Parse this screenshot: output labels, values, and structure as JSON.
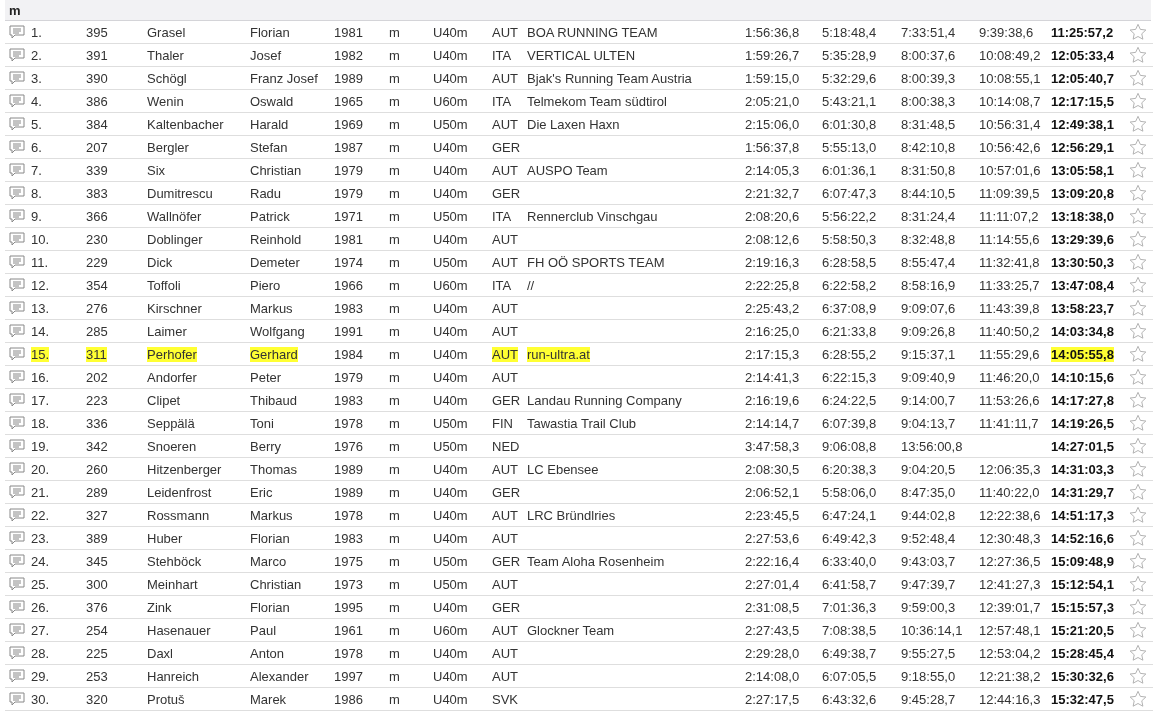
{
  "group": {
    "label": "m"
  },
  "rows": [
    {
      "rank": "1.",
      "bib": "395",
      "last_name": "Grasel",
      "first_name": "Florian",
      "year": "1981",
      "sex": "m",
      "category": "U40m",
      "nation": "AUT",
      "club": "BOA RUNNING TEAM",
      "split_1": "1:56:36,8",
      "split_2": "5:18:48,4",
      "split_3": "7:33:51,4",
      "split_4": "9:39:38,6",
      "final_time": "11:25:57,2",
      "highlighted": false,
      "favorite": false
    },
    {
      "rank": "2.",
      "bib": "391",
      "last_name": "Thaler",
      "first_name": "Josef",
      "year": "1982",
      "sex": "m",
      "category": "U40m",
      "nation": "ITA",
      "club": "VERTICAL ULTEN",
      "split_1": "1:59:26,7",
      "split_2": "5:35:28,9",
      "split_3": "8:00:37,6",
      "split_4": "10:08:49,2",
      "final_time": "12:05:33,4",
      "highlighted": false,
      "favorite": false
    },
    {
      "rank": "3.",
      "bib": "390",
      "last_name": "Schögl",
      "first_name": "Franz Josef",
      "year": "1989",
      "sex": "m",
      "category": "U40m",
      "nation": "AUT",
      "club": "Bjak's Running Team Austria",
      "split_1": "1:59:15,0",
      "split_2": "5:32:29,6",
      "split_3": "8:00:39,3",
      "split_4": "10:08:55,1",
      "final_time": "12:05:40,7",
      "highlighted": false,
      "favorite": false
    },
    {
      "rank": "4.",
      "bib": "386",
      "last_name": "Wenin",
      "first_name": "Oswald",
      "year": "1965",
      "sex": "m",
      "category": "U60m",
      "nation": "ITA",
      "club": "Telmekom Team südtirol",
      "split_1": "2:05:21,0",
      "split_2": "5:43:21,1",
      "split_3": "8:00:38,3",
      "split_4": "10:14:08,7",
      "final_time": "12:17:15,5",
      "highlighted": false,
      "favorite": false
    },
    {
      "rank": "5.",
      "bib": "384",
      "last_name": "Kaltenbacher",
      "first_name": "Harald",
      "year": "1969",
      "sex": "m",
      "category": "U50m",
      "nation": "AUT",
      "club": "Die Laxen Haxn",
      "split_1": "2:15:06,0",
      "split_2": "6:01:30,8",
      "split_3": "8:31:48,5",
      "split_4": "10:56:31,4",
      "final_time": "12:49:38,1",
      "highlighted": false,
      "favorite": false
    },
    {
      "rank": "6.",
      "bib": "207",
      "last_name": "Bergler",
      "first_name": "Stefan",
      "year": "1987",
      "sex": "m",
      "category": "U40m",
      "nation": "GER",
      "split_1": "1:56:37,8",
      "split_2": "5:55:13,0",
      "split_3": "8:42:10,8",
      "split_4": "10:56:42,6",
      "final_time": "12:56:29,1",
      "highlighted": false,
      "favorite": false
    },
    {
      "rank": "7.",
      "bib": "339",
      "last_name": "Six",
      "first_name": "Christian",
      "year": "1979",
      "sex": "m",
      "category": "U40m",
      "nation": "AUT",
      "club": "AUSPO Team",
      "split_1": "2:14:05,3",
      "split_2": "6:01:36,1",
      "split_3": "8:31:50,8",
      "split_4": "10:57:01,6",
      "final_time": "13:05:58,1",
      "highlighted": false,
      "favorite": false
    },
    {
      "rank": "8.",
      "bib": "383",
      "last_name": "Dumitrescu",
      "first_name": "Radu",
      "year": "1979",
      "sex": "m",
      "category": "U40m",
      "nation": "GER",
      "split_1": "2:21:32,7",
      "split_2": "6:07:47,3",
      "split_3": "8:44:10,5",
      "split_4": "11:09:39,5",
      "final_time": "13:09:20,8",
      "highlighted": false,
      "favorite": false
    },
    {
      "rank": "9.",
      "bib": "366",
      "last_name": "Wallnöfer",
      "first_name": "Patrick",
      "year": "1971",
      "sex": "m",
      "category": "U50m",
      "nation": "ITA",
      "club": "Rennerclub Vinschgau",
      "split_1": "2:08:20,6",
      "split_2": "5:56:22,2",
      "split_3": "8:31:24,4",
      "split_4": "11:11:07,2",
      "final_time": "13:18:38,0",
      "highlighted": false,
      "favorite": false
    },
    {
      "rank": "10.",
      "bib": "230",
      "last_name": "Doblinger",
      "first_name": "Reinhold",
      "year": "1981",
      "sex": "m",
      "category": "U40m",
      "nation": "AUT",
      "split_1": "2:08:12,6",
      "split_2": "5:58:50,3",
      "split_3": "8:32:48,8",
      "split_4": "11:14:55,6",
      "final_time": "13:29:39,6",
      "highlighted": false,
      "favorite": false
    },
    {
      "rank": "11.",
      "bib": "229",
      "last_name": "Dick",
      "first_name": "Demeter",
      "year": "1974",
      "sex": "m",
      "category": "U50m",
      "nation": "AUT",
      "club": "FH OÖ SPORTS TEAM",
      "split_1": "2:19:16,3",
      "split_2": "6:28:58,5",
      "split_3": "8:55:47,4",
      "split_4": "11:32:41,8",
      "final_time": "13:30:50,3",
      "highlighted": false,
      "favorite": false
    },
    {
      "rank": "12.",
      "bib": "354",
      "last_name": "Toffoli",
      "first_name": "Piero",
      "year": "1966",
      "sex": "m",
      "category": "U60m",
      "nation": "ITA",
      "club": "//",
      "split_1": "2:22:25,8",
      "split_2": "6:22:58,2",
      "split_3": "8:58:16,9",
      "split_4": "11:33:25,7",
      "final_time": "13:47:08,4",
      "highlighted": false,
      "favorite": false
    },
    {
      "rank": "13.",
      "bib": "276",
      "last_name": "Kirschner",
      "first_name": "Markus",
      "year": "1983",
      "sex": "m",
      "category": "U40m",
      "nation": "AUT",
      "split_1": "2:25:43,2",
      "split_2": "6:37:08,9",
      "split_3": "9:09:07,6",
      "split_4": "11:43:39,8",
      "final_time": "13:58:23,7",
      "highlighted": false,
      "favorite": false
    },
    {
      "rank": "14.",
      "bib": "285",
      "last_name": "Laimer",
      "first_name": "Wolfgang",
      "year": "1991",
      "sex": "m",
      "category": "U40m",
      "nation": "AUT",
      "split_1": "2:16:25,0",
      "split_2": "6:21:33,8",
      "split_3": "9:09:26,8",
      "split_4": "11:40:50,2",
      "final_time": "14:03:34,8",
      "highlighted": false,
      "favorite": false
    },
    {
      "rank": "15.",
      "bib": "311",
      "last_name": "Perhofer",
      "first_name": "Gerhard",
      "year": "1984",
      "sex": "m",
      "category": "U40m",
      "nation": "AUT",
      "club": "run-ultra.at",
      "split_1": "2:17:15,3",
      "split_2": "6:28:55,2",
      "split_3": "9:15:37,1",
      "split_4": "11:55:29,6",
      "final_time": "14:05:55,8",
      "highlighted": true,
      "favorite": false
    },
    {
      "rank": "16.",
      "bib": "202",
      "last_name": "Andorfer",
      "first_name": "Peter",
      "year": "1979",
      "sex": "m",
      "category": "U40m",
      "nation": "AUT",
      "split_1": "2:14:41,3",
      "split_2": "6:22:15,3",
      "split_3": "9:09:40,9",
      "split_4": "11:46:20,0",
      "final_time": "14:10:15,6",
      "highlighted": false,
      "favorite": false
    },
    {
      "rank": "17.",
      "bib": "223",
      "last_name": "Clipet",
      "first_name": "Thibaud",
      "year": "1983",
      "sex": "m",
      "category": "U40m",
      "nation": "GER",
      "club": "Landau Running Company",
      "split_1": "2:16:19,6",
      "split_2": "6:24:22,5",
      "split_3": "9:14:00,7",
      "split_4": "11:53:26,6",
      "final_time": "14:17:27,8",
      "highlighted": false,
      "favorite": false
    },
    {
      "rank": "18.",
      "bib": "336",
      "last_name": "Seppälä",
      "first_name": "Toni",
      "year": "1978",
      "sex": "m",
      "category": "U50m",
      "nation": "FIN",
      "club": "Tawastia Trail Club",
      "split_1": "2:14:14,7",
      "split_2": "6:07:39,8",
      "split_3": "9:04:13,7",
      "split_4": "11:41:11,7",
      "final_time": "14:19:26,5",
      "highlighted": false,
      "favorite": false
    },
    {
      "rank": "19.",
      "bib": "342",
      "last_name": "Snoeren",
      "first_name": "Berry",
      "year": "1976",
      "sex": "m",
      "category": "U50m",
      "nation": "NED",
      "split_1": "3:47:58,3",
      "split_2": "9:06:08,8",
      "split_3": "13:56:00,8",
      "final_time": "14:27:01,5",
      "highlighted": false,
      "favorite": false
    },
    {
      "rank": "20.",
      "bib": "260",
      "last_name": "Hitzenberger",
      "first_name": "Thomas",
      "year": "1989",
      "sex": "m",
      "category": "U40m",
      "nation": "AUT",
      "club": "LC Ebensee",
      "split_1": "2:08:30,5",
      "split_2": "6:20:38,3",
      "split_3": "9:04:20,5",
      "split_4": "12:06:35,3",
      "final_time": "14:31:03,3",
      "highlighted": false,
      "favorite": false
    },
    {
      "rank": "21.",
      "bib": "289",
      "last_name": "Leidenfrost",
      "first_name": "Eric",
      "year": "1989",
      "sex": "m",
      "category": "U40m",
      "nation": "GER",
      "split_1": "2:06:52,1",
      "split_2": "5:58:06,0",
      "split_3": "8:47:35,0",
      "split_4": "11:40:22,0",
      "final_time": "14:31:29,7",
      "highlighted": false,
      "favorite": false
    },
    {
      "rank": "22.",
      "bib": "327",
      "last_name": "Rossmann",
      "first_name": "Markus",
      "year": "1978",
      "sex": "m",
      "category": "U40m",
      "nation": "AUT",
      "club": "LRC Bründlries",
      "split_1": "2:23:45,5",
      "split_2": "6:47:24,1",
      "split_3": "9:44:02,8",
      "split_4": "12:22:38,6",
      "final_time": "14:51:17,3",
      "highlighted": false,
      "favorite": false
    },
    {
      "rank": "23.",
      "bib": "389",
      "last_name": "Huber",
      "first_name": "Florian",
      "year": "1983",
      "sex": "m",
      "category": "U40m",
      "nation": "AUT",
      "split_1": "2:27:53,6",
      "split_2": "6:49:42,3",
      "split_3": "9:52:48,4",
      "split_4": "12:30:48,3",
      "final_time": "14:52:16,6",
      "highlighted": false,
      "favorite": false
    },
    {
      "rank": "24.",
      "bib": "345",
      "last_name": "Stehböck",
      "first_name": "Marco",
      "year": "1975",
      "sex": "m",
      "category": "U50m",
      "nation": "GER",
      "club": "Team Aloha Rosenheim",
      "split_1": "2:22:16,4",
      "split_2": "6:33:40,0",
      "split_3": "9:43:03,7",
      "split_4": "12:27:36,5",
      "final_time": "15:09:48,9",
      "highlighted": false,
      "favorite": false
    },
    {
      "rank": "25.",
      "bib": "300",
      "last_name": "Meinhart",
      "first_name": "Christian",
      "year": "1973",
      "sex": "m",
      "category": "U50m",
      "nation": "AUT",
      "split_1": "2:27:01,4",
      "split_2": "6:41:58,7",
      "split_3": "9:47:39,7",
      "split_4": "12:41:27,3",
      "final_time": "15:12:54,1",
      "highlighted": false,
      "favorite": false
    },
    {
      "rank": "26.",
      "bib": "376",
      "last_name": "Zink",
      "first_name": "Florian",
      "year": "1995",
      "sex": "m",
      "category": "U40m",
      "nation": "GER",
      "split_1": "2:31:08,5",
      "split_2": "7:01:36,3",
      "split_3": "9:59:00,3",
      "split_4": "12:39:01,7",
      "final_time": "15:15:57,3",
      "highlighted": false,
      "favorite": false
    },
    {
      "rank": "27.",
      "bib": "254",
      "last_name": "Hasenauer",
      "first_name": "Paul",
      "year": "1961",
      "sex": "m",
      "category": "U60m",
      "nation": "AUT",
      "club": "Glockner Team",
      "split_1": "2:27:43,5",
      "split_2": "7:08:38,5",
      "split_3": "10:36:14,1",
      "split_4": "12:57:48,1",
      "final_time": "15:21:20,5",
      "highlighted": false,
      "favorite": false
    },
    {
      "rank": "28.",
      "bib": "225",
      "last_name": "Daxl",
      "first_name": "Anton",
      "year": "1978",
      "sex": "m",
      "category": "U40m",
      "nation": "AUT",
      "split_1": "2:29:28,0",
      "split_2": "6:49:38,7",
      "split_3": "9:55:27,5",
      "split_4": "12:53:04,2",
      "final_time": "15:28:45,4",
      "highlighted": false,
      "favorite": false
    },
    {
      "rank": "29.",
      "bib": "253",
      "last_name": "Hanreich",
      "first_name": "Alexander",
      "year": "1997",
      "sex": "m",
      "category": "U40m",
      "nation": "AUT",
      "split_1": "2:14:08,0",
      "split_2": "6:07:05,5",
      "split_3": "9:18:55,0",
      "split_4": "12:21:38,2",
      "final_time": "15:30:32,6",
      "highlighted": false,
      "favorite": false
    },
    {
      "rank": "30.",
      "bib": "320",
      "last_name": "Protuš",
      "first_name": "Marek",
      "year": "1986",
      "sex": "m",
      "category": "U40m",
      "nation": "SVK",
      "split_1": "2:27:17,5",
      "split_2": "6:43:32,6",
      "split_3": "9:45:28,7",
      "split_4": "12:44:16,3",
      "final_time": "15:32:47,5",
      "highlighted": false,
      "favorite": false
    }
  ]
}
